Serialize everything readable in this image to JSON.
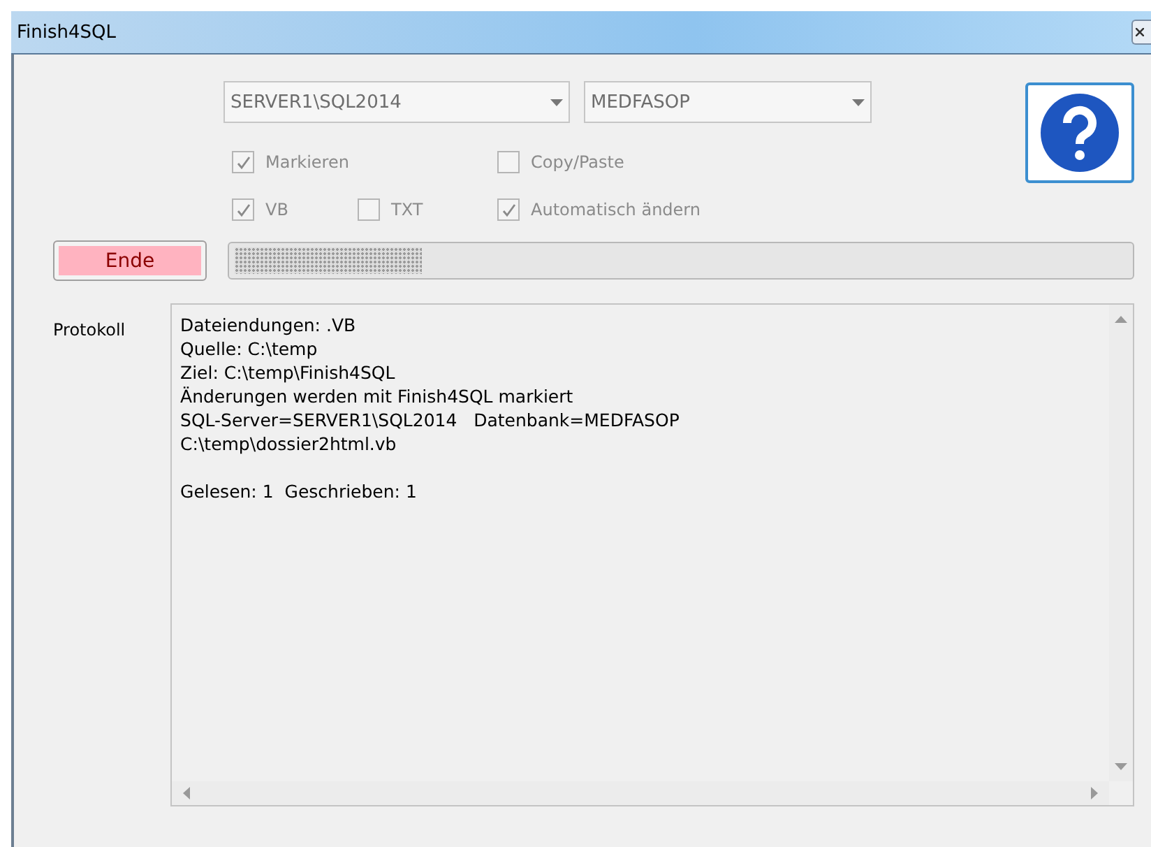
{
  "window": {
    "title": "Finish4SQL"
  },
  "server_combo": {
    "value": "SERVER1\\SQL2014",
    "disabled": true
  },
  "database_combo": {
    "value": "MEDFASOP",
    "disabled": true
  },
  "checkboxes": [
    {
      "label": "Markieren",
      "checked": true,
      "disabled": true
    },
    {
      "label": "Copy/Paste",
      "checked": false,
      "disabled": true
    },
    {
      "label": "VB",
      "checked": true,
      "disabled": true
    },
    {
      "label": "TXT",
      "checked": false,
      "disabled": true
    },
    {
      "label": "Automatisch ändern",
      "checked": true,
      "disabled": true
    }
  ],
  "end_button": {
    "label": "Ende"
  },
  "progress": {
    "level": 0.21
  },
  "log": {
    "label": "Protokoll",
    "lines": [
      "Dateiendungen: .VB",
      "Quelle: C:\\temp",
      "Ziel: C:\\temp\\Finish4SQL",
      "Änderungen werden mit Finish4SQL markiert",
      "SQL-Server=SERVER1\\SQL2014   Datenbank=MEDFASOP",
      "C:\\temp\\dossier2html.vb"
    ],
    "summary": "Gelesen: 1  Geschrieben: 1"
  }
}
